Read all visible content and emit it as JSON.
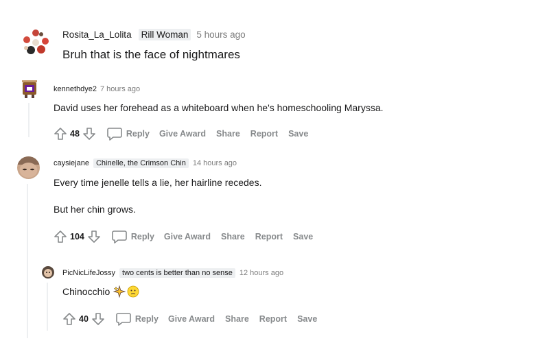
{
  "comments": [
    {
      "username": "Rosita_La_Lolita",
      "flair": "Rill Woman",
      "time": "5 hours ago",
      "body": [
        "Bruh that is the face of nightmares"
      ]
    },
    {
      "username": "kennethdye2",
      "flair": "",
      "time": "7 hours ago",
      "body": [
        "David uses her forehead as a whiteboard when he's homeschooling Maryssa."
      ],
      "votes": "48"
    },
    {
      "username": "caysiejane",
      "flair": "Chinelle, the Crimson Chin",
      "time": "14 hours ago",
      "body": [
        "Every time jenelle tells a lie, her hairline recedes.",
        "But her chin grows."
      ],
      "votes": "104"
    },
    {
      "username": "PicNicLifeJossy",
      "flair": "two cents is better than no sense",
      "time": "12 hours ago",
      "body": [
        "Chinocchio"
      ],
      "votes": "40"
    }
  ],
  "actions": {
    "reply": "Reply",
    "give_award": "Give Award",
    "share": "Share",
    "report": "Report",
    "save": "Save"
  },
  "icons": [
    "upvote-arrow-icon",
    "downvote-arrow-icon",
    "reply-bubble-icon",
    "sparkle-emoji-icon",
    "thinking-emoji-icon"
  ],
  "colors": {
    "meta_gray": "#7c7c7c",
    "action_gray": "#878a8c",
    "flair_bg": "#edeff1"
  }
}
